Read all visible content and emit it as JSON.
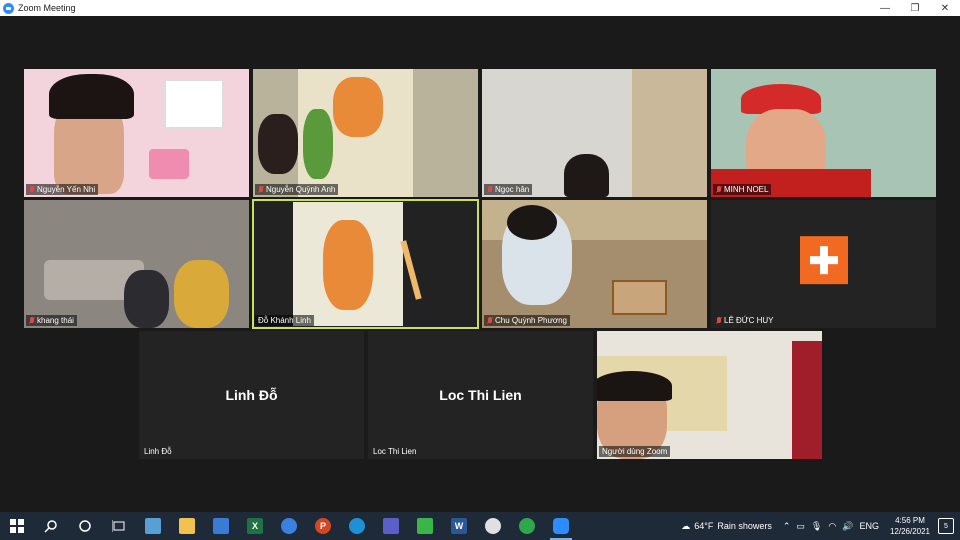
{
  "window": {
    "title": "Zoom Meeting",
    "minimize": "—",
    "maximize": "❐",
    "close": "✕"
  },
  "participants": [
    {
      "name": "Nguyễn Yến Nhi"
    },
    {
      "name": "Nguyễn Quỳnh Anh"
    },
    {
      "name": "Ngọc hân"
    },
    {
      "name": "MINH NOEL"
    },
    {
      "name": "khang thái"
    },
    {
      "name": "Đỗ Khánh Linh"
    },
    {
      "name": "Chu Quỳnh Phương"
    },
    {
      "name": "LÊ ĐỨC HUY"
    },
    {
      "name": "Linh Đỗ",
      "display_name": "Linh Đỗ"
    },
    {
      "name": "Loc Thi Lien",
      "display_name": "Loc Thi Lien"
    },
    {
      "name": "Người dùng Zoom"
    }
  ],
  "taskbar": {
    "weather_temp": "64°F",
    "weather_text": "Rain showers",
    "language": "ENG",
    "time": "4:56 PM",
    "date": "12/26/2021",
    "notifications": "5",
    "apps": [
      "start-icon",
      "search-icon",
      "cortana-icon",
      "task-view-icon",
      "calendar-icon",
      "file-explorer-icon",
      "mail-icon",
      "excel-icon",
      "chrome-icon",
      "powerpoint-icon",
      "edge-icon",
      "teams-icon",
      "camtasia-icon",
      "word-icon",
      "chrome-user-icon",
      "greenshot-icon",
      "zoom-icon"
    ],
    "app_badges": {
      "excel": "X",
      "powerpoint": "P",
      "word": "W"
    }
  },
  "colors": {
    "active_speaker": "#c8e05a",
    "muted": "#e04848",
    "avatar": "#f26a22",
    "taskbar": "#1f2a38"
  }
}
